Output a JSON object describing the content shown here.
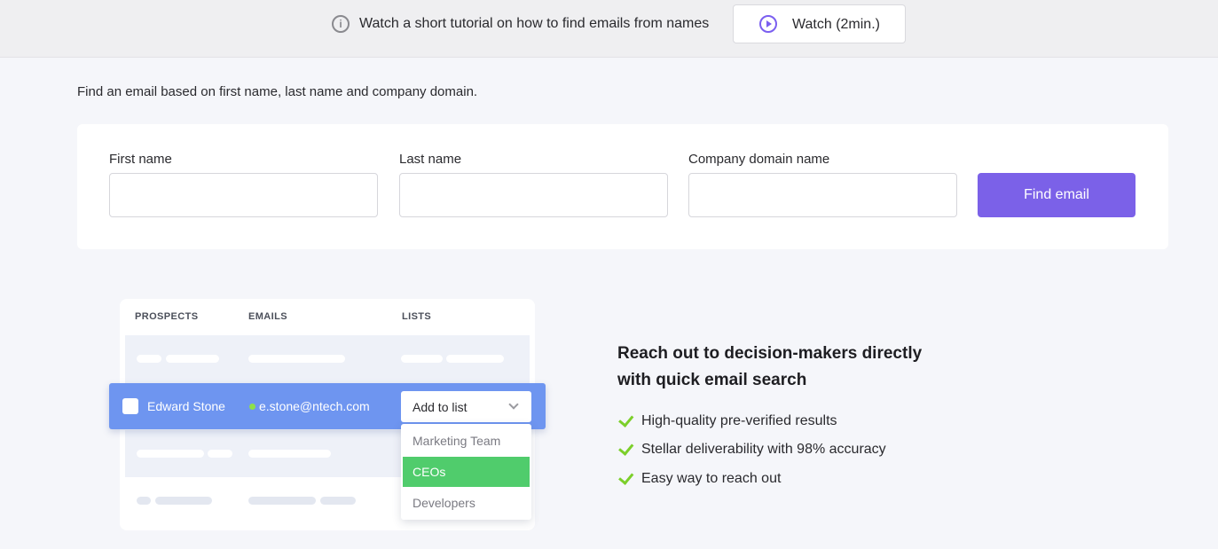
{
  "tutorial_bar": {
    "text": "Watch a short tutorial on how to find emails from names",
    "watch_label": "Watch (2min.)",
    "info_icon": "info-circle-icon",
    "play_icon": "play-circle-icon"
  },
  "intro": "Find an email based on first name, last name and company domain.",
  "form": {
    "first_name_label": "First name",
    "first_name_value": "",
    "last_name_label": "Last name",
    "last_name_value": "",
    "domain_label": "Company domain name",
    "domain_value": "",
    "submit_label": "Find email"
  },
  "illustration": {
    "columns": [
      "PROSPECTS",
      "EMAILS",
      "LISTS"
    ],
    "row": {
      "name": "Edward Stone",
      "email": "e.stone@ntech.com",
      "list_select": "Add to list"
    },
    "dropdown_options": [
      "Marketing Team",
      "CEOs",
      "Developers"
    ],
    "selected_option": "CEOs"
  },
  "promo": {
    "heading_line1": "Reach out to decision-makers directly",
    "heading_line2": "with quick email search",
    "features": [
      "High-quality pre-verified results",
      "Stellar deliverability with 98% accuracy",
      "Easy way to reach out"
    ]
  },
  "colors": {
    "accent": "#7b61e8",
    "row_highlight": "#6e95f0",
    "selected_option": "#50cc6c",
    "check": "#7ccf2a"
  }
}
